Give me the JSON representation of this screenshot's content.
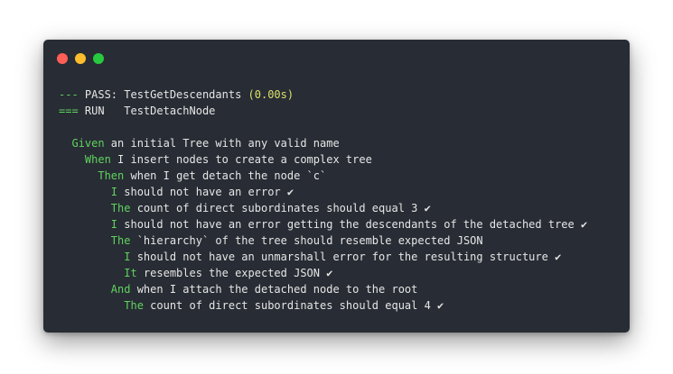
{
  "window": {
    "controls": {
      "close_color": "#ff5f56",
      "minimize_color": "#ffbd2e",
      "maximize_color": "#27c93f"
    }
  },
  "terminal": {
    "lines": [
      {
        "indent": "",
        "prefix": "---",
        "text": " PASS: TestGetDescendants ",
        "extra": "(0.00s)"
      },
      {
        "indent": "",
        "prefix": "===",
        "text": " RUN   TestDetachNode",
        "extra": ""
      },
      {
        "blank": true
      },
      {
        "indent": "  ",
        "keyword": "Given",
        "text": " an initial Tree with any valid name",
        "check": ""
      },
      {
        "indent": "    ",
        "keyword": "When",
        "text": " I insert nodes to create a complex tree",
        "check": ""
      },
      {
        "indent": "      ",
        "keyword": "Then",
        "text": " when I get detach the node `c`",
        "check": ""
      },
      {
        "indent": "        ",
        "keyword": "I",
        "text": " should not have an error ",
        "check": "✔"
      },
      {
        "indent": "        ",
        "keyword": "The",
        "text": " count of direct subordinates should equal 3 ",
        "check": "✔"
      },
      {
        "indent": "        ",
        "keyword": "I",
        "text": " should not have an error getting the descendants of the detached tree ",
        "check": "✔"
      },
      {
        "indent": "        ",
        "keyword": "The",
        "text": " `hierarchy` of the tree should resemble expected JSON",
        "check": ""
      },
      {
        "indent": "          ",
        "keyword": "I",
        "text": " should not have an unmarshall error for the resulting structure ",
        "check": "✔"
      },
      {
        "indent": "          ",
        "keyword": "It",
        "text": " resembles the expected JSON ",
        "check": "✔"
      },
      {
        "indent": "        ",
        "keyword": "And",
        "text": " when I attach the detached node to the root",
        "check": ""
      },
      {
        "indent": "          ",
        "keyword": "The",
        "text": " count of direct subordinates should equal 4 ",
        "check": "✔"
      }
    ]
  }
}
